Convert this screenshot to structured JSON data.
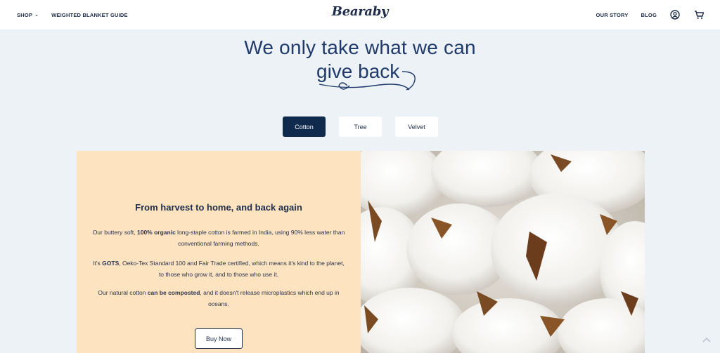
{
  "header": {
    "shop_label": "SHOP",
    "guide_label": "WEIGHTED BLANKET GUIDE",
    "logo": "Bearaby",
    "story_label": "OUR STORY",
    "blog_label": "BLOG"
  },
  "hero": {
    "line1": "We only take what we can",
    "line2": "give back"
  },
  "tabs": [
    {
      "label": "Cotton",
      "active": true
    },
    {
      "label": "Tree",
      "active": false
    },
    {
      "label": "Velvet",
      "active": false
    }
  ],
  "panel": {
    "title": "From harvest to home, and back again",
    "p1a": "Our buttery soft, ",
    "p1b": "100% organic",
    "p1c": " long-staple cotton is farmed in India, using 90% less water than conventional farming methods.",
    "p2a": "It's ",
    "p2b": "GOTS",
    "p2c": ", Oeko-Tex Standard 100 and Fair Trade certified, which means it's kind to the planet, to those who grow it, and to those who use it.",
    "p3a": "Our natural cotton ",
    "p3b": "can be composted",
    "p3c": ", and it doesn't release microplastics which end up in oceans.",
    "button": "Buy Now"
  },
  "colors": {
    "navy": "#0f2a4d",
    "panel_bg": "#fde3bf",
    "page_bg": "#edf2f7"
  }
}
